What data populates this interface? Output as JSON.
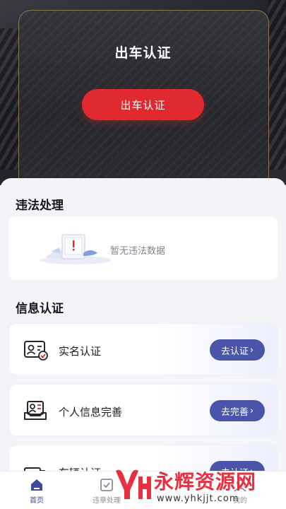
{
  "hero": {
    "title": "出车认证",
    "button_label": "出车认证"
  },
  "violations": {
    "section_title": "违法处理",
    "empty_text": "暂无违法数据"
  },
  "info_auth": {
    "section_title": "信息认证",
    "items": [
      {
        "label": "实名认证",
        "button": "去认证",
        "icon": "id-card-icon"
      },
      {
        "label": "个人信息完善",
        "button": "去完善",
        "icon": "profile-tray-icon"
      },
      {
        "label": "车辆认证",
        "button": "去认证",
        "icon": "vehicle-icon"
      }
    ]
  },
  "bottom_nav": {
    "items": [
      {
        "label": "首页",
        "icon": "home-icon",
        "active": true
      },
      {
        "label": "违章处理",
        "icon": "checklist-icon",
        "active": false
      },
      {
        "label": "我的",
        "icon": "user-icon",
        "active": false
      }
    ]
  },
  "watermark": {
    "text": "永辉资源网",
    "url": "www.yhkjjt.com"
  },
  "colors": {
    "primary_red": "#e02a2f",
    "accent_blue": "#4a54a8",
    "nav_active": "#3c4aa0"
  }
}
